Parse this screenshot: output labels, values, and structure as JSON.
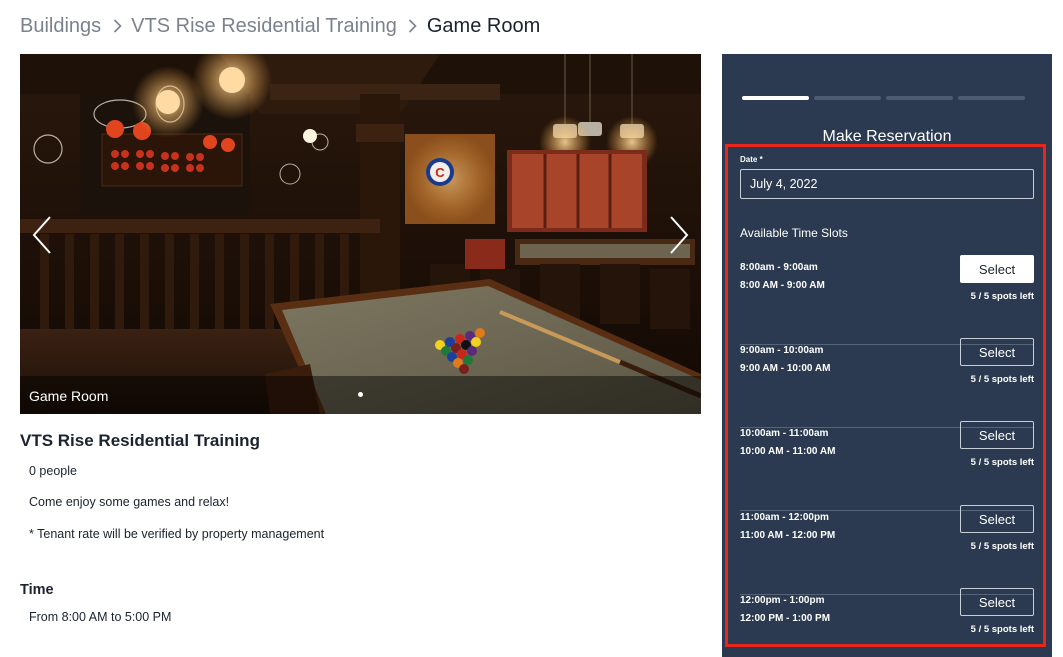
{
  "breadcrumb": {
    "items": [
      "Buildings",
      "VTS Rise Residential Training",
      "Game Room"
    ]
  },
  "carousel": {
    "caption": "Game Room",
    "slide_count": 1,
    "active_slide": 1
  },
  "details": {
    "title": "VTS Rise Residential Training",
    "capacity": "0 people",
    "description": "Come enjoy some games and relax!",
    "note": "* Tenant rate will be verified by property management",
    "time_heading": "Time",
    "time_value": "From 8:00 AM to 5:00 PM"
  },
  "reservation": {
    "title": "Make Reservation",
    "progress_steps": 4,
    "progress_current": 1,
    "date_label": "Date *",
    "date_value": "July 4, 2022",
    "slots_heading": "Available Time Slots",
    "slots": [
      {
        "name": "8:00am - 9:00am",
        "range": "8:00 AM - 9:00 AM",
        "button": "Select",
        "spots": "5 / 5 spots left"
      },
      {
        "name": "9:00am - 10:00am",
        "range": "9:00 AM - 10:00 AM",
        "button": "Select",
        "spots": "5 / 5 spots left"
      },
      {
        "name": "10:00am - 11:00am",
        "range": "10:00 AM - 11:00 AM",
        "button": "Select",
        "spots": "5 / 5 spots left"
      },
      {
        "name": "11:00am - 12:00pm",
        "range": "11:00 AM - 12:00 PM",
        "button": "Select",
        "spots": "5 / 5 spots left"
      },
      {
        "name": "12:00pm - 1:00pm",
        "range": "12:00 PM - 1:00 PM",
        "button": "Select",
        "spots": "5 / 5 spots left"
      }
    ]
  },
  "colors": {
    "panel_bg": "#2b3a50",
    "highlight": "#e8261b",
    "crumb_muted": "#7a8290",
    "text_dark": "#1b2330"
  },
  "icons": {
    "breadcrumb_separator": "chevron-right-icon",
    "carousel_prev": "chevron-left-icon",
    "carousel_next": "chevron-right-icon"
  }
}
